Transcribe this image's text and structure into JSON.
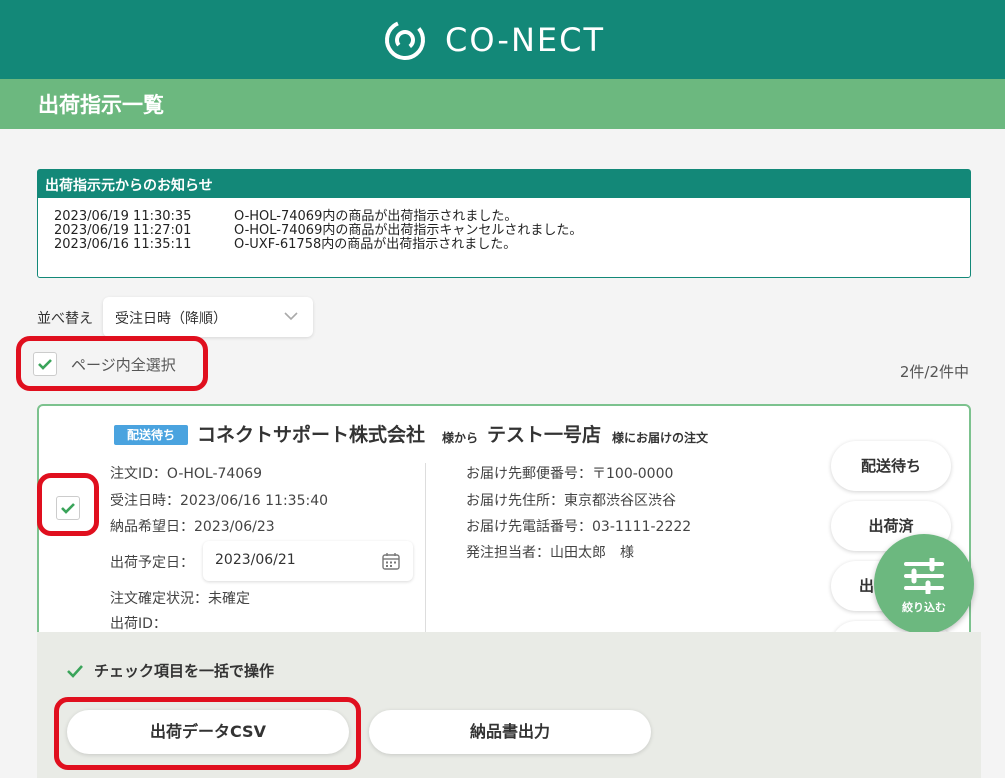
{
  "header": {
    "brand": "CO-NECT"
  },
  "page": {
    "title": "出荷指示一覧"
  },
  "notice": {
    "title": "出荷指示元からのお知らせ",
    "items": [
      {
        "datetime": "2023/06/19 11:30:35",
        "message": "O-HOL-74069内の商品が出荷指示されました。"
      },
      {
        "datetime": "2023/06/19 11:27:01",
        "message": "O-HOL-74069内の商品が出荷指示キャンセルされました。"
      },
      {
        "datetime": "2023/06/16 11:35:11",
        "message": "O-UXF-61758内の商品が出荷指示されました。"
      }
    ]
  },
  "sort": {
    "label": "並べ替え",
    "value": "受注日時（降順）"
  },
  "select_all": {
    "label": "ページ内全選択",
    "checked": true
  },
  "count": "2件/2件中",
  "order": {
    "status_tag": "配送待ち",
    "company": "コネクトサポート株式会社",
    "from_suffix": "様から",
    "shop": "テスト一号店",
    "deliver_suffix": "様にお届けの注文",
    "checked": true,
    "order_id": "注文ID：O-HOL-74069",
    "order_date": "受注日時：2023/06/16 11:35:40",
    "desired_date": "納品希望日：2023/06/23",
    "ship_date_label": "出荷予定日：",
    "ship_date_value": "2023/06/21",
    "confirm_status": "注文確定状況：未確定",
    "ship_id": "出荷ID：",
    "postal": "お届け先郵便番号：〒100-0000",
    "address": "お届け先住所：東京都渋谷区渋谷",
    "phone": "お届け先電話番号：03-1111-2222",
    "person": "発注担当者：山田太郎　様",
    "buttons": [
      "配送待ち",
      "出荷済",
      "出"
    ]
  },
  "fab": {
    "label": "絞り込む"
  },
  "bulk": {
    "title": "チェック項目を一括で操作",
    "csv_button": "出荷データCSV",
    "invoice_button": "納品書出力"
  },
  "colors": {
    "header": "#138878",
    "title_bar": "#6cb87f",
    "status_tag": "#4aa3df",
    "highlight": "#e00f1e"
  }
}
